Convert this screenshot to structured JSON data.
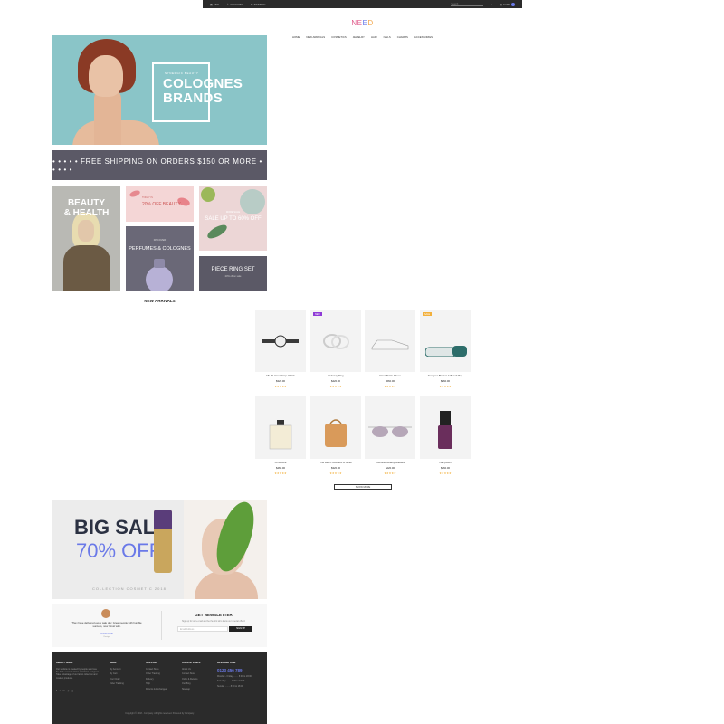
{
  "topbar": {
    "language": "ENG",
    "account": "ACCOUNT",
    "settings": "SETTING",
    "search_placeholder": "Search",
    "cart": "CART"
  },
  "logo": {
    "part1": "NE",
    "part2": "E",
    "part3": "D"
  },
  "nav": [
    "HOME",
    "NEW ARRIVALS",
    "COSMETICS",
    "JEWELRY",
    "HAIR",
    "NAILS",
    "CHARMS",
    "ACCESSORIES"
  ],
  "hero": {
    "small": "SYNERGIC BEAUTY",
    "line1": "COLOGNES",
    "line2": "BRANDS"
  },
  "shipping": "• • • • •  FREE SHIPPING ON ORDERS $150 OR MORE  • • • • •",
  "promos": {
    "beauty": {
      "line1": "BEAUTY",
      "line2": "& HEALTH"
    },
    "off": {
      "small": "TODAY IS",
      "big": "20% OFF BEAUTY"
    },
    "perfumes": {
      "small": "DISCOVER",
      "big": "PERFUMES & COLOGNES"
    },
    "sale": {
      "small": "MORE SALE",
      "big": "SALE UP TO 60% OFF"
    },
    "ring": {
      "big": "PIECE RING SET",
      "small": "20% off on sale"
    }
  },
  "new_arrivals": {
    "title": "NEW ARRIVALS",
    "products": [
      {
        "name": "Mk-20 Hand Strap Watch",
        "price": "$320.00",
        "stars": "★★★★★",
        "badge": "",
        "badge_color": ""
      },
      {
        "name": "Delicacy Ring",
        "price": "$420.00",
        "stars": "★★★★★",
        "badge": "NEW",
        "badge_color": "#8e3ad6"
      },
      {
        "name": "Glass Bottle Shoes",
        "price": "$560.00",
        "stars": "★★★★★",
        "badge": "",
        "badge_color": ""
      },
      {
        "name": "Designer Blanket & Beach Bag",
        "price": "$860.00",
        "stars": "★★★★★",
        "badge": "SALE",
        "badge_color": "#f2b03c"
      },
      {
        "name": "Jo Malone",
        "price": "$460.00",
        "stars": "★★★★★",
        "badge": "",
        "badge_color": ""
      },
      {
        "name": "The Bee's Cosmetic & Smell",
        "price": "$320.00",
        "stars": "★★★★★",
        "badge": "",
        "badge_color": ""
      },
      {
        "name": "Cosmetic Beauty Glasses",
        "price": "$220.00",
        "stars": "★★★★★",
        "badge": "",
        "badge_color": ""
      },
      {
        "name": "Nail polish",
        "price": "$260.00",
        "stars": "★★★★★",
        "badge": "",
        "badge_color": ""
      }
    ],
    "show_more": "SHOW MORE"
  },
  "big_sale": {
    "line1": "BIG SALE",
    "line2": "70% OFF",
    "collection": "COLLECTION COSMETIC 2018"
  },
  "testimonial": {
    "quote": "They have delivered every sale day. Great people with humble success, now I trust with.",
    "author": "ANNA DOE",
    "role": "Design"
  },
  "newsletter": {
    "title": "GET NEWSLETTER",
    "text": "Sign up for our e-mail and be the first who know our special offers!",
    "placeholder": "Email Address",
    "button": "SIGN UP"
  },
  "footer": {
    "about": {
      "title": "ABOUT SHOP",
      "text": "Our website is created by people who love the high-end collections of fashion designers. Take advantage of our latest collection and modern products."
    },
    "shop": {
      "title": "SHOP",
      "items": [
        "My Account",
        "My Cart",
        "Your Order",
        "Order Tracking"
      ]
    },
    "support": {
      "title": "SUPPORT",
      "items": [
        "Contact Store",
        "Order Tracking",
        "Delivery",
        "Help",
        "Returns & Exchanges"
      ]
    },
    "links": {
      "title": "USEFUL LINKS",
      "items": [
        "About Us",
        "Contact Store",
        "Order & Returns",
        "Our Blog",
        "Sitemap"
      ]
    },
    "opening": {
      "title": "OPENING TIME",
      "phone": "0123 456 789",
      "items": [
        "Monday - Friday ........ 8:00 to 18:00",
        "Saturday ........ 8:00 to 18:00",
        "Sunday ........ 8:00 to 18:00"
      ]
    },
    "social": [
      "f",
      "t",
      "in",
      "p",
      "g"
    ],
    "copyright": "Copyright © 2018 - Company. All rights reserved. Powered by Company."
  }
}
